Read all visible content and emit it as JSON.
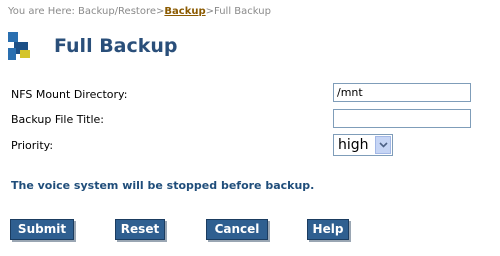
{
  "breadcrumb": {
    "prefix": "You are Here: Backup/Restore>",
    "link": "Backup",
    "suffix": ">Full Backup"
  },
  "page": {
    "title": "Full Backup"
  },
  "form": {
    "nfs_mount_label": "NFS Mount Directory:",
    "nfs_mount_value": "/mnt",
    "backup_title_label": "Backup File Title:",
    "backup_title_value": "",
    "priority_label": "Priority:",
    "priority_value": "high"
  },
  "notice": "The voice system will be stopped before backup.",
  "buttons": {
    "submit": "Submit",
    "reset": "Reset",
    "cancel": "Cancel",
    "help": "Help"
  },
  "colors": {
    "title": "#2a4f7a",
    "button_bg": "#2f5f90",
    "notice": "#1f4d7a",
    "breadcrumb_link": "#8b5a00"
  },
  "icons": {
    "logo": "app-logo-icon",
    "dropdown": "chevron-down-icon"
  }
}
